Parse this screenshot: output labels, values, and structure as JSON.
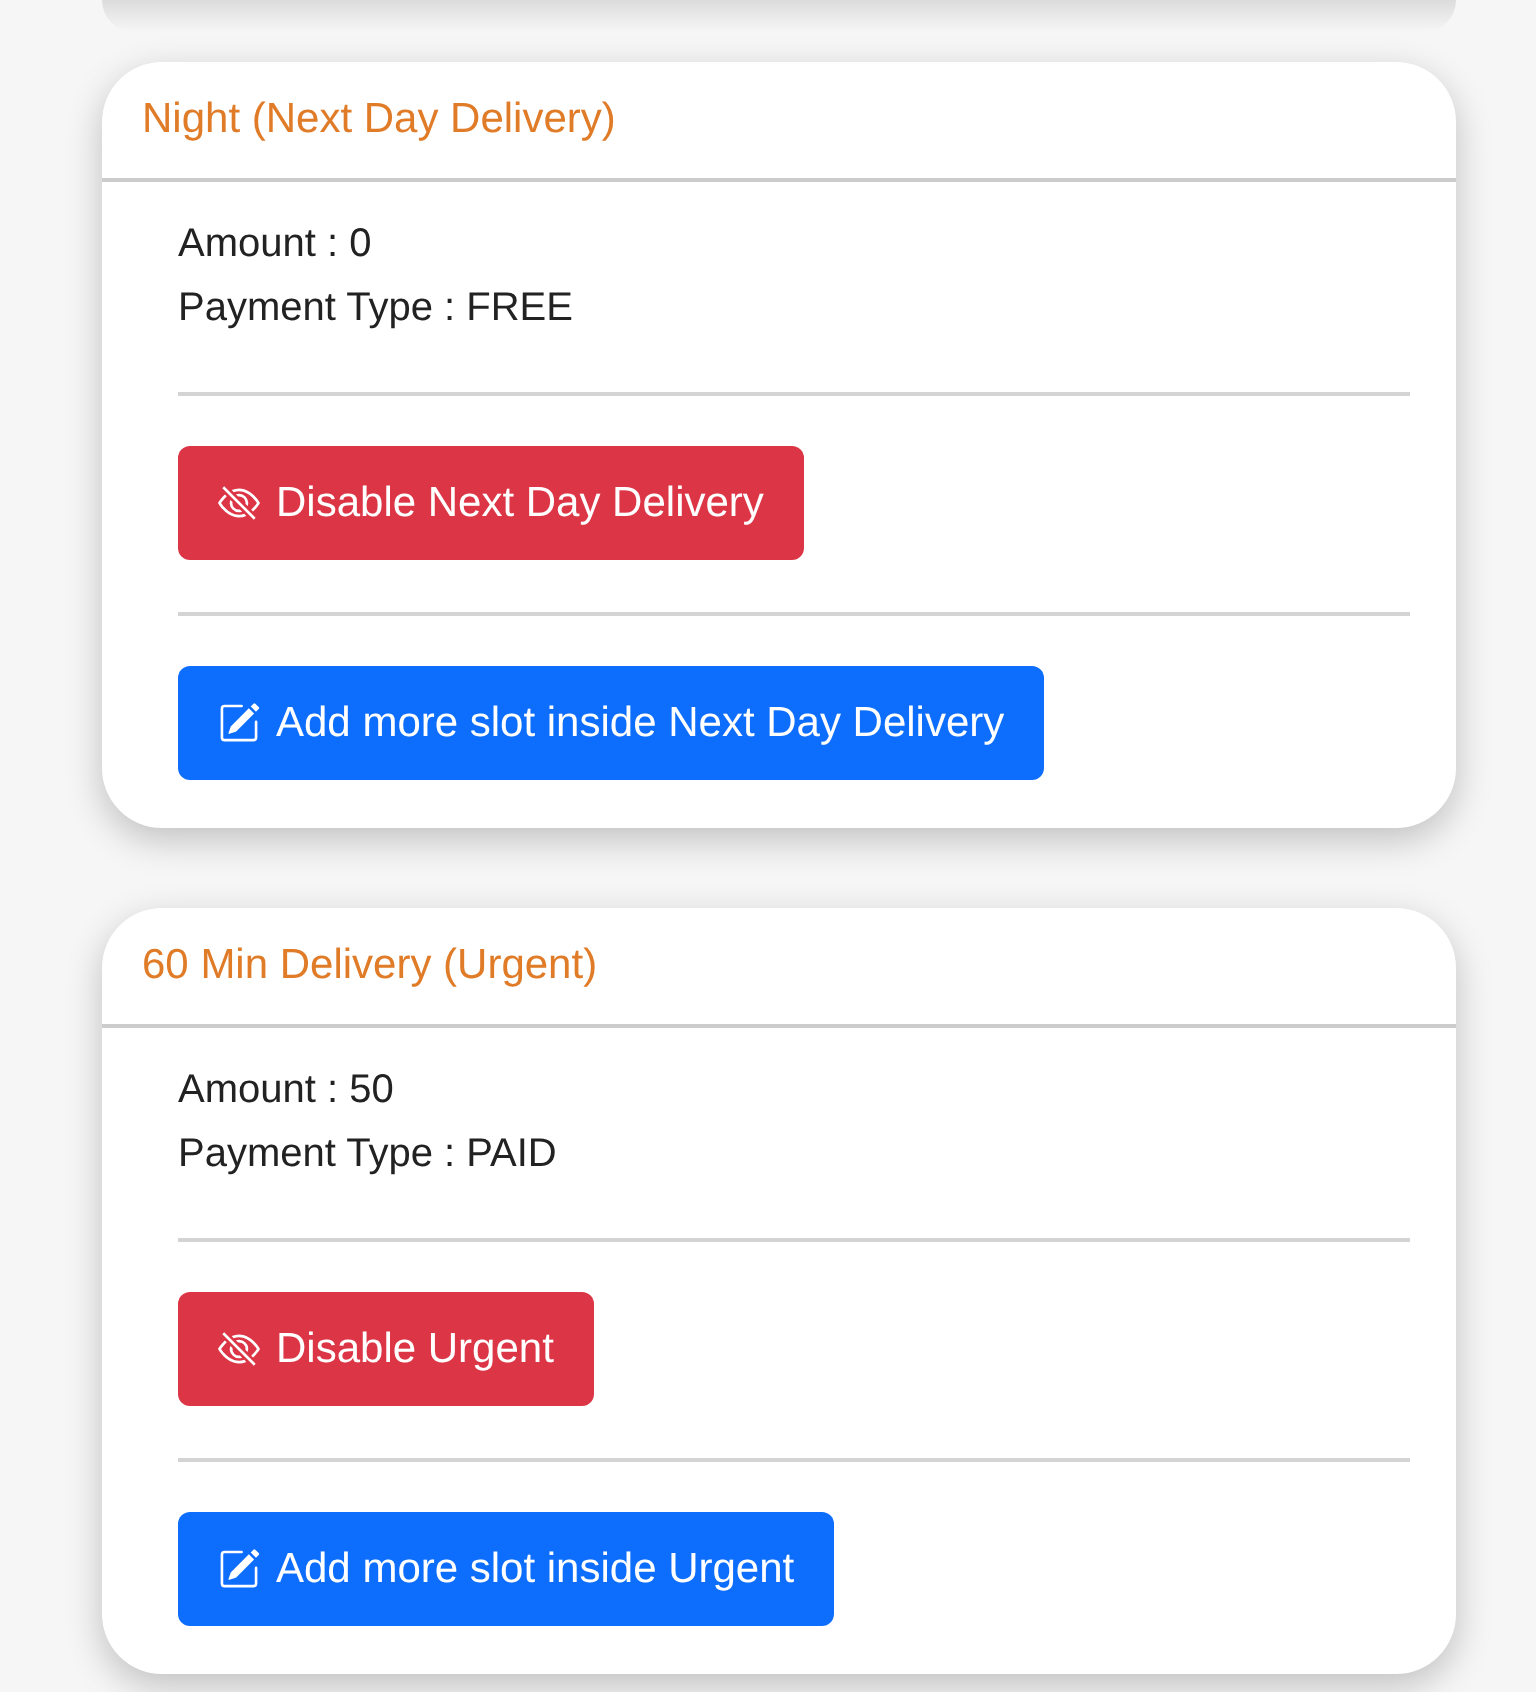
{
  "cards": [
    {
      "title": "Night (Next Day Delivery)",
      "lines": [
        "Amount : 0",
        "Payment Type : FREE"
      ],
      "actions": [
        {
          "kind": "disable",
          "label": "Disable Next Day Delivery"
        },
        {
          "kind": "add",
          "label": "Add more slot inside Next Day Delivery"
        }
      ]
    },
    {
      "title": "60 Min Delivery (Urgent)",
      "lines": [
        "Amount : 50",
        "Payment Type : PAID"
      ],
      "actions": [
        {
          "kind": "disable",
          "label": "Disable Urgent"
        },
        {
          "kind": "add",
          "label": "Add more slot inside Urgent"
        }
      ]
    }
  ]
}
